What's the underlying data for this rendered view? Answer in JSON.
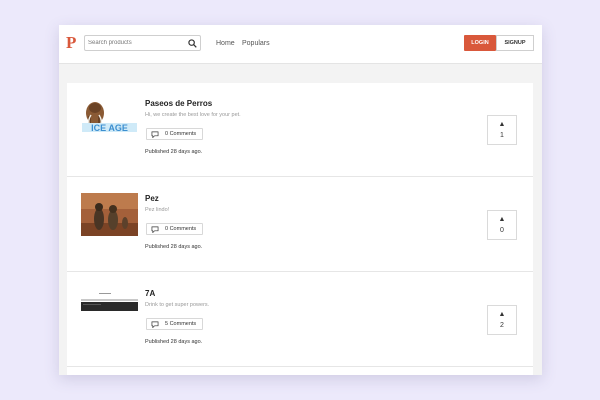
{
  "app": {
    "logo_letter": "P",
    "brand_color": "#d9583b"
  },
  "header": {
    "search_placeholder": "Search products",
    "search_icon": "search-icon",
    "nav": [
      "Home",
      "Populars"
    ],
    "login_label": "LOGIN",
    "signup_label": "SIGNUP"
  },
  "posts": [
    {
      "title": "Paseos de Perros",
      "description": "Hi, we create the best love for your pet.",
      "comments_label": "0 Comments",
      "published": "Published 28 days ago.",
      "votes": "1",
      "thumbnail_text": "ICE AGE"
    },
    {
      "title": "Pez",
      "description": "Pez lindo!",
      "comments_label": "0 Comments",
      "published": "Published 28 days ago.",
      "votes": "0"
    },
    {
      "title": "7A",
      "description": "Drink to get super powers.",
      "comments_label": "5 Comments",
      "published": "Published 28 days ago.",
      "votes": "2"
    }
  ],
  "vote_arrow": "▲"
}
